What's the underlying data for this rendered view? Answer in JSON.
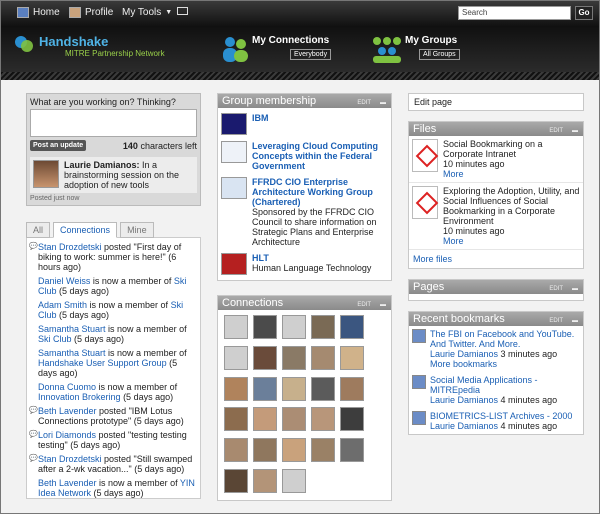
{
  "topbar": {
    "home": "Home",
    "profile": "Profile",
    "mytools": "My Tools",
    "search_value": "Search",
    "go": "Go"
  },
  "brand": {
    "name": "Handshake",
    "subtitle": "MITRE Partnership Network"
  },
  "header": {
    "connections": "My Connections",
    "connections_sub": "Everybody",
    "groups": "My Groups",
    "groups_sub": "All Groups"
  },
  "status": {
    "prompt": "What are you working on? Thinking?",
    "post_button": "Post an update",
    "chars_count": "140",
    "chars_suffix": "characters left",
    "user": "Laurie Damianos:",
    "message": "In a brainstorming session on the adoption of new tools",
    "posted": "Posted just now"
  },
  "tabs": [
    "All",
    "Connections",
    "Mine"
  ],
  "feed": [
    {
      "pre": "Stan Drozdetski",
      "txt": " posted \"First day of biking to work: summer is here!\" (6 hours ago)",
      "q": true
    },
    {
      "pre": "Daniel Weiss",
      "txt": " is now a member of ",
      "post": "Ski Club",
      "tail": " (5 days ago)"
    },
    {
      "pre": "Adam Smith",
      "txt": " is now a member of ",
      "post": "Ski Club",
      "tail": " (5 days ago)"
    },
    {
      "pre": "Samantha Stuart",
      "txt": " is now a member of ",
      "post": "Ski Club",
      "tail": " (5 days ago)"
    },
    {
      "pre": "Samantha Stuart",
      "txt": " is now a member of ",
      "post": "Handshake User Support Group",
      "tail": " (5 days ago)"
    },
    {
      "pre": "Donna Cuomo",
      "txt": " is now a member of ",
      "post": "Innovation Brokering",
      "tail": " (5 days ago)"
    },
    {
      "pre": "Beth Lavender",
      "txt": " posted \"IBM Lotus Connections prototype\" (5 days ago)",
      "q": true
    },
    {
      "pre": "Lori Diamonds",
      "txt": " posted \"testing testing testing\" (5 days ago)",
      "q": true
    },
    {
      "pre": "Stan Drozdetski",
      "txt": " posted \"Still swamped after a 2-wk vacation...\" (5 days ago)",
      "q": true
    },
    {
      "pre": "Beth Lavender",
      "txt": " is now a member of ",
      "post": "YIN Idea Network",
      "tail": " (5 days ago)"
    },
    {
      "pre": "Beth Lavender",
      "txt": " made a profile update (6 days ago)"
    }
  ],
  "groups": {
    "title": "Group membership",
    "edit": "EDIT",
    "items": [
      {
        "name": "IBM",
        "desc": ""
      },
      {
        "name": "Leveraging Cloud Computing Concepts within the Federal Government",
        "desc": ""
      },
      {
        "name": "FFRDC CIO Enterprise Architecture Working Group (Chartered)",
        "desc": "Sponsored by the FFRDC CIO Council to share information on Strategic Plans and Enterprise Architecture"
      },
      {
        "name": "HLT",
        "desc": "Human Language Technology"
      }
    ]
  },
  "connections": {
    "title": "Connections",
    "edit": "EDIT"
  },
  "right": {
    "edit_page": "Edit page",
    "files_title": "Files",
    "files_edit": "EDIT",
    "files": [
      {
        "name": "Social Bookmarking on a Corporate Intranet",
        "time": "10 minutes ago",
        "more": "More"
      },
      {
        "name": "Exploring the Adoption, Utility, and Social Influences of Social Bookmarking in a Corporate Environment",
        "time": "10 minutes ago",
        "more": "More"
      }
    ],
    "more_files": "More files",
    "pages_title": "Pages",
    "pages_edit": "EDIT",
    "bm_title": "Recent bookmarks",
    "bm_edit": "EDIT",
    "bookmarks": [
      {
        "name": "The FBI on Facebook and YouTube. And Twitter. And More.",
        "who": "Laurie Damianos",
        "time": " 3 minutes ago",
        "more": "More bookmarks"
      },
      {
        "name": "Social Media Applications - MITREpedia",
        "who": "Laurie Damianos",
        "time": " 4 minutes ago"
      },
      {
        "name": "BIOMETRICS-LIST Archives - 2000",
        "who": "Laurie Damianos",
        "time": " 4 minutes ago"
      }
    ]
  }
}
